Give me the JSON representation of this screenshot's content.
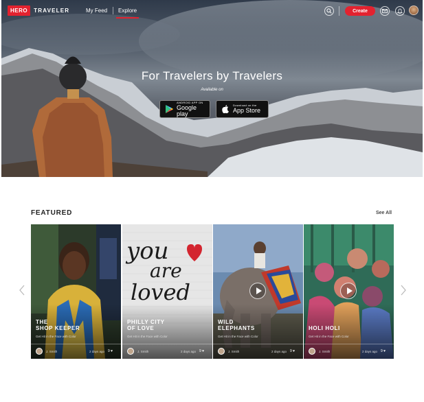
{
  "nav": {
    "logo_box": "HERO",
    "logo_text": "TRAVELER",
    "links": [
      "My Feed",
      "Explore"
    ],
    "create_label": "Create",
    "accent": "#e3222f"
  },
  "hero": {
    "title": "For Travelers by Travelers",
    "available": "Available on",
    "google": {
      "small": "ANDROID APP ON",
      "big": "Google play"
    },
    "apple": {
      "small": "Download on the",
      "big": "App Store"
    }
  },
  "featured": {
    "title": "FEATURED",
    "see_all": "See All",
    "cards": [
      {
        "title_line1": "THE",
        "title_line2": "SHOP KEEPER",
        "subtitle": "Get Hit in the Face with Color",
        "author": "J. Smith",
        "time": "2 days ago",
        "likes": "9",
        "video": false
      },
      {
        "title_line1": "PHILLY CITY",
        "title_line2": "OF LOVE",
        "subtitle": "Get Hit in the Face with Color",
        "author": "J. Smith",
        "time": "2 days ago",
        "likes": "9",
        "video": false,
        "art_words": [
          "you",
          "are",
          "loved"
        ]
      },
      {
        "title_line1": "WILD",
        "title_line2": "ELEPHANTS",
        "subtitle": "Get Hit in the Face with Color",
        "author": "J. Smith",
        "time": "2 days ago",
        "likes": "9",
        "video": true
      },
      {
        "title_line1": "HOLI HOLI",
        "title_line2": "",
        "subtitle": "Get Hit in the Face with Color",
        "author": "J. Smith",
        "time": "2 days ago",
        "likes": "9",
        "video": true
      }
    ]
  }
}
